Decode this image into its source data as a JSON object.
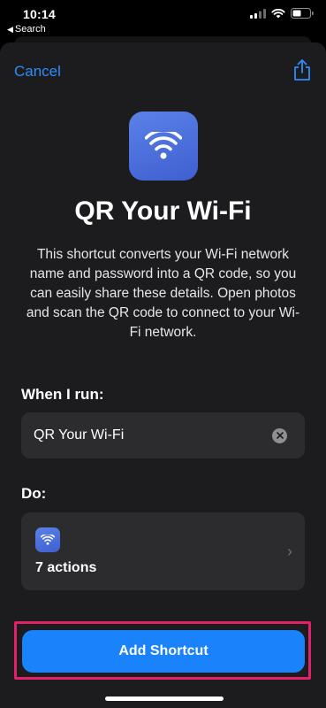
{
  "status_bar": {
    "time": "10:14",
    "back_label": "Search",
    "icons": [
      "signal-icon",
      "wifi-icon",
      "battery-icon"
    ]
  },
  "header": {
    "cancel_label": "Cancel",
    "share_icon": "share-icon"
  },
  "shortcut": {
    "icon": "wifi-icon",
    "title": "QR Your Wi-Fi",
    "description": "This shortcut converts your Wi-Fi network name and password into a QR code, so you can easily share these details. Open photos and scan the QR code to connect to your Wi-Fi network."
  },
  "when_i_run": {
    "label": "When I run:",
    "value": "QR Your Wi-Fi"
  },
  "do": {
    "label": "Do:",
    "actions_count": "7 actions"
  },
  "footer": {
    "add_label": "Add Shortcut"
  },
  "colors": {
    "accent": "#2f8cf9",
    "button": "#1a82fb",
    "highlight": "#e3206a",
    "sheet": "#1c1c1e",
    "card": "#2c2c2e"
  }
}
